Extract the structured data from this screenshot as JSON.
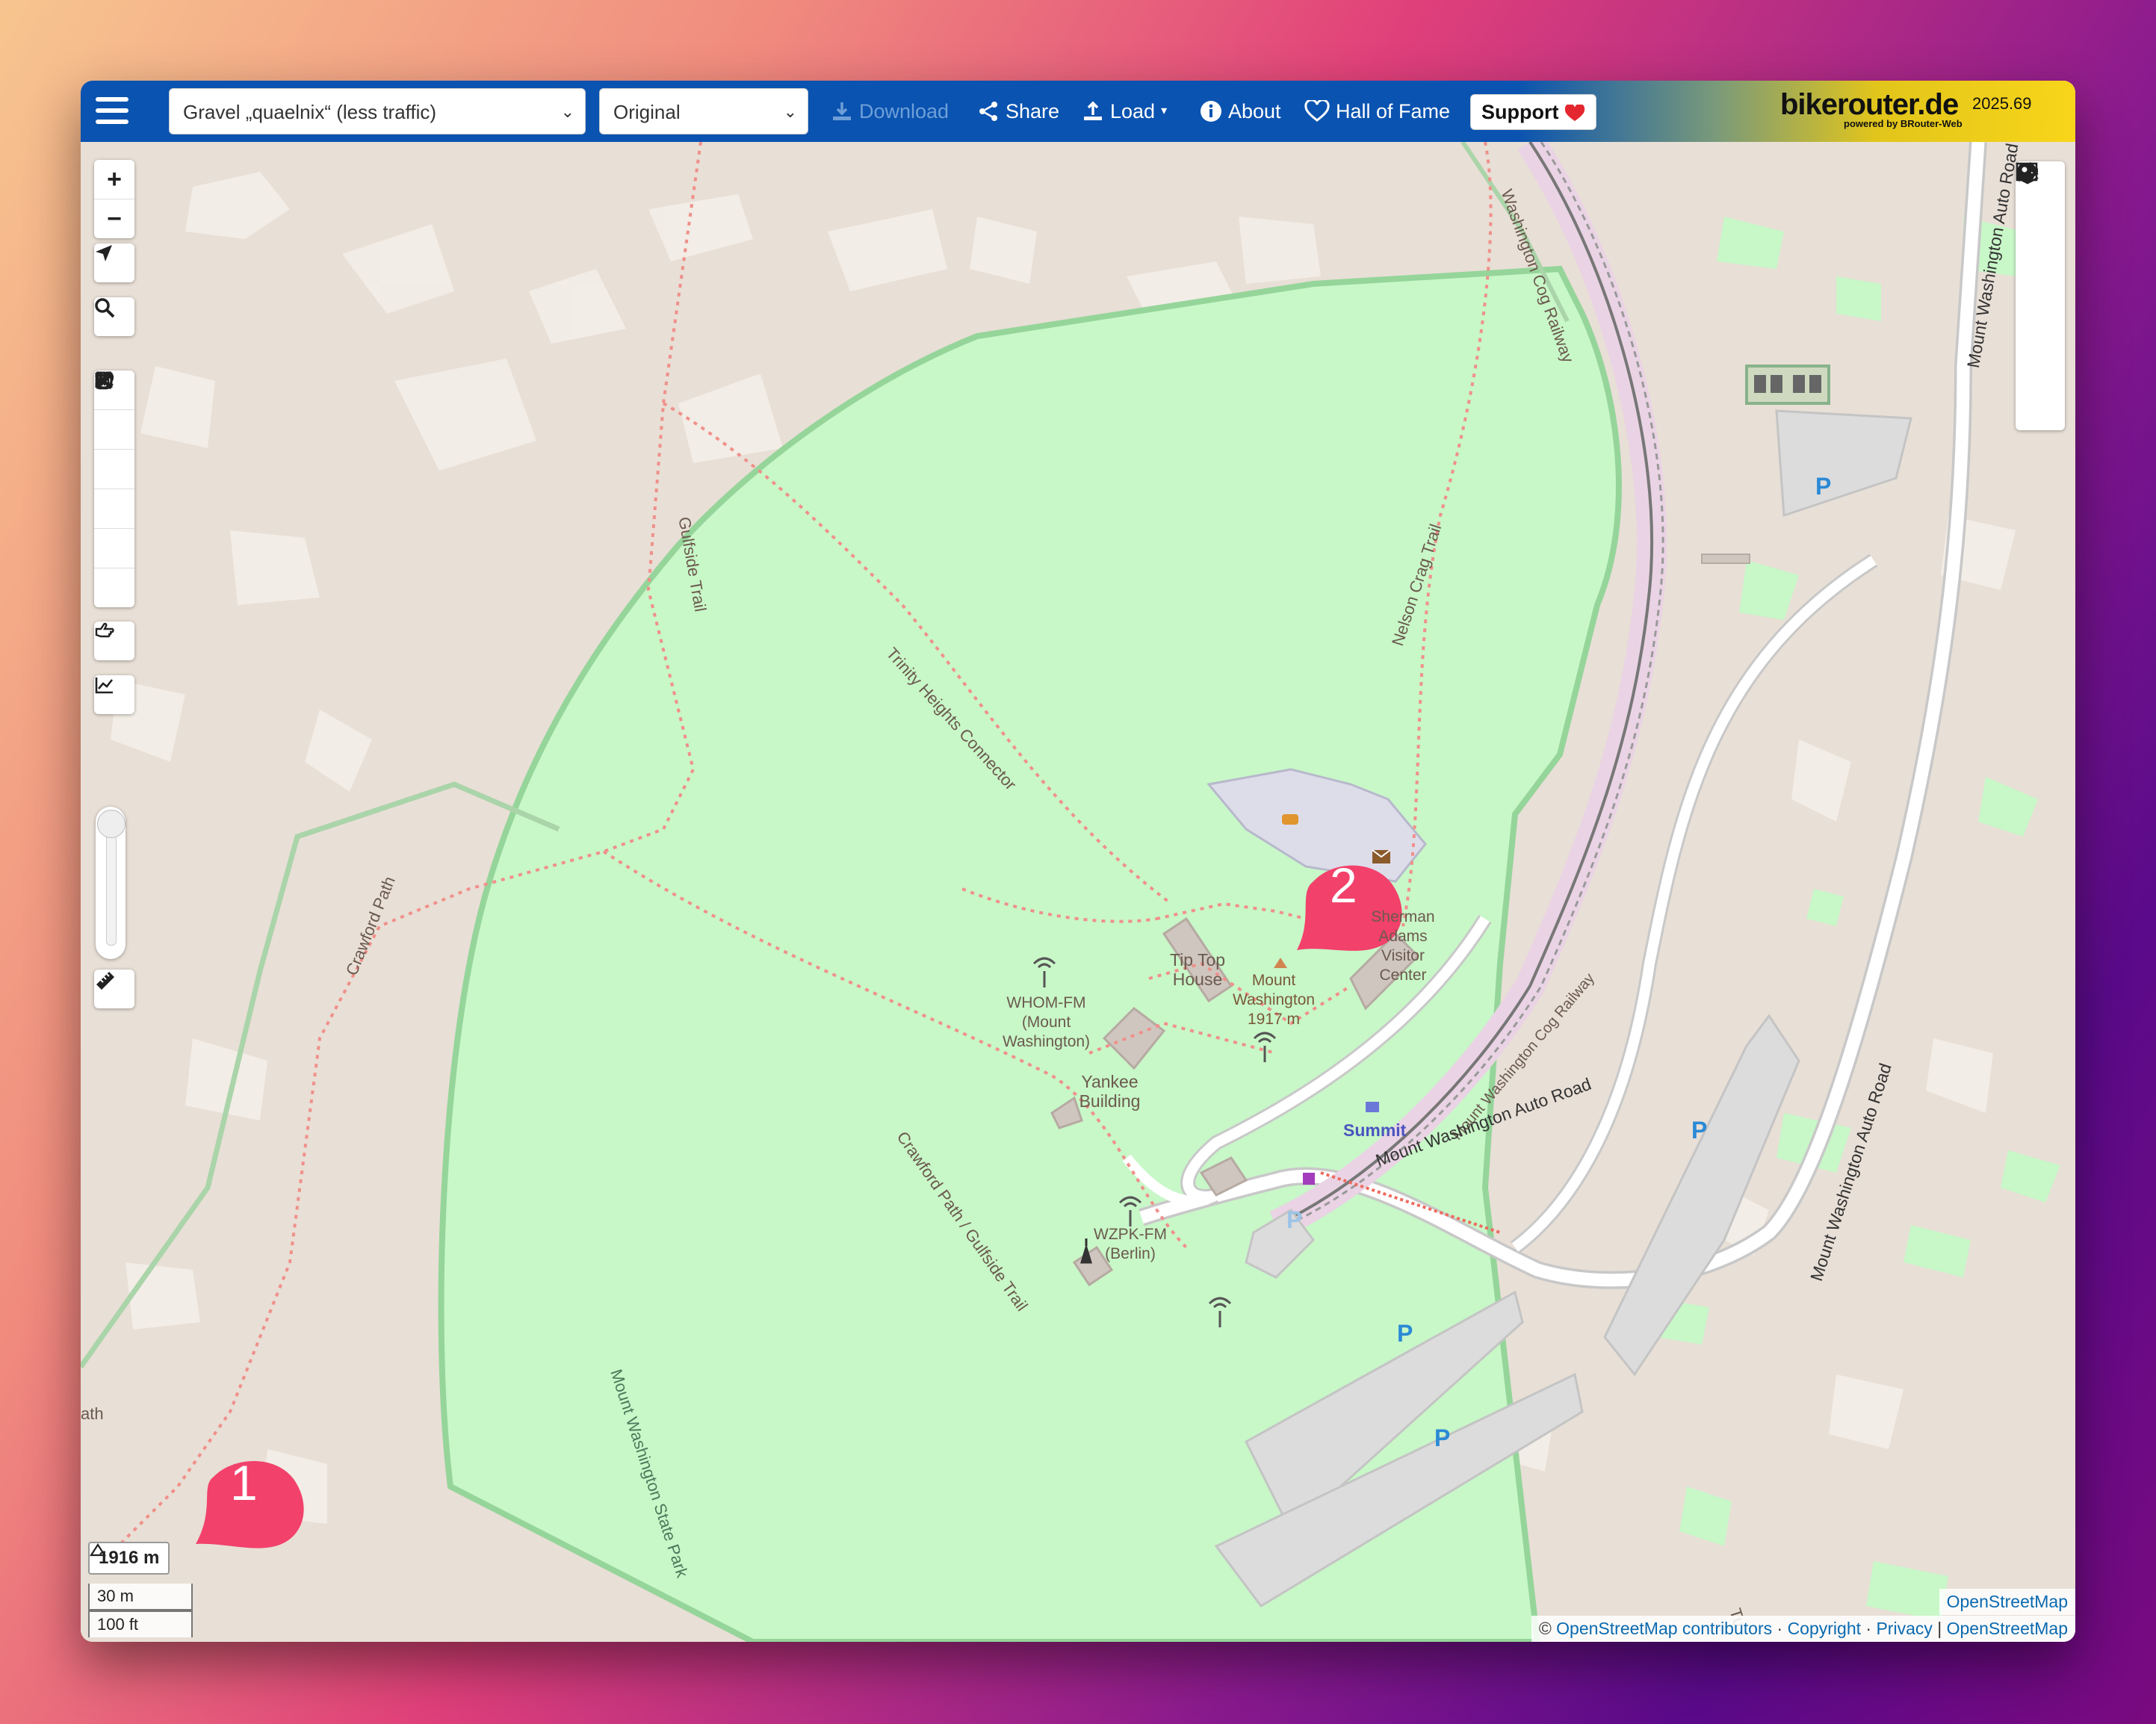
{
  "navbar": {
    "profile_select": "Gravel „quaelnix“ (less traffic)",
    "style_select": "Original",
    "download": "Download",
    "share": "Share",
    "load": "Load",
    "about": "About",
    "hall_of_fame": "Hall of Fame",
    "support": "Support",
    "support_icon": "heart-emoji",
    "brand": "bikerouter.de",
    "brand_sub": "powered by BRouter-Web",
    "version": "2025.69"
  },
  "map": {
    "labels": {
      "cog_railway_top": "Washington Cog Railway",
      "auto_road_top": "Mount Washington Auto Road",
      "gulfside": "Gulfside Trail",
      "nelson_crag": "Nelson Crag Trail",
      "trinity": "Trinity Heights Connector",
      "crawford": "Crawford Path",
      "tip_top": "Tip Top House",
      "mount_washington": "Mount Washington 1917 m",
      "whom": "WHOM-FM (Mount Washington)",
      "visitor": "Sherman Adams Visitor Center",
      "cog_mid": "Mount Washington Cog Railway",
      "yankee": "Yankee Building",
      "crawford_gulfside": "Crawford Path / Gulfside Trail",
      "summit": "Summit",
      "auto_road_mid": "Mount Washington Auto Road",
      "auto_road_right": "Mount Washington Auto Road",
      "wzpk": "WZPK-FM (Berlin)",
      "state_park": "Mount Washington State Park",
      "ath": "ath",
      "tu": "Tu",
      "parking": "P"
    },
    "markers": [
      {
        "label": "1"
      },
      {
        "label": "2"
      }
    ],
    "elevation_badge": "1916 m",
    "scale_metric": "30 m",
    "scale_imperial": "100 ft",
    "attribution_top": "OpenStreetMap",
    "attribution": {
      "prefix": "©",
      "osm_contributors": "OpenStreetMap contributors",
      "copyright": "Copyright",
      "privacy": "Privacy",
      "osm": "OpenStreetMap",
      "sep_dot": "·",
      "sep_bar": "|"
    }
  },
  "colors": {
    "navbar_blue": "#0a53b0",
    "brand_yellow": "#f8d51a",
    "park_green": "#c8f7c8",
    "terrain": "#e8dfd6",
    "marker_pink": "#f2416b",
    "parking_blue": "#2b8ad6"
  }
}
